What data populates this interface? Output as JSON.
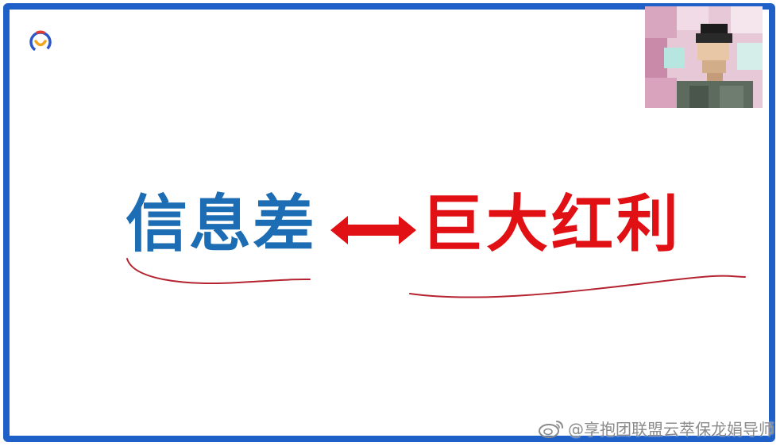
{
  "slide": {
    "left_phrase": "信息差",
    "right_phrase": "巨大红利",
    "arrow_icon": "double-arrow-icon",
    "logo_icon": "smile-logo-icon"
  },
  "colors": {
    "frame": "#1f5fc8",
    "left_phrase": "#1c6db3",
    "right_phrase": "#e01014",
    "arrow": "#e01014"
  },
  "watermark": {
    "icon": "weibo-icon",
    "text": "@享抱团联盟云萃保龙娟导师"
  },
  "webcam": {
    "icon": "presenter-video-icon"
  }
}
